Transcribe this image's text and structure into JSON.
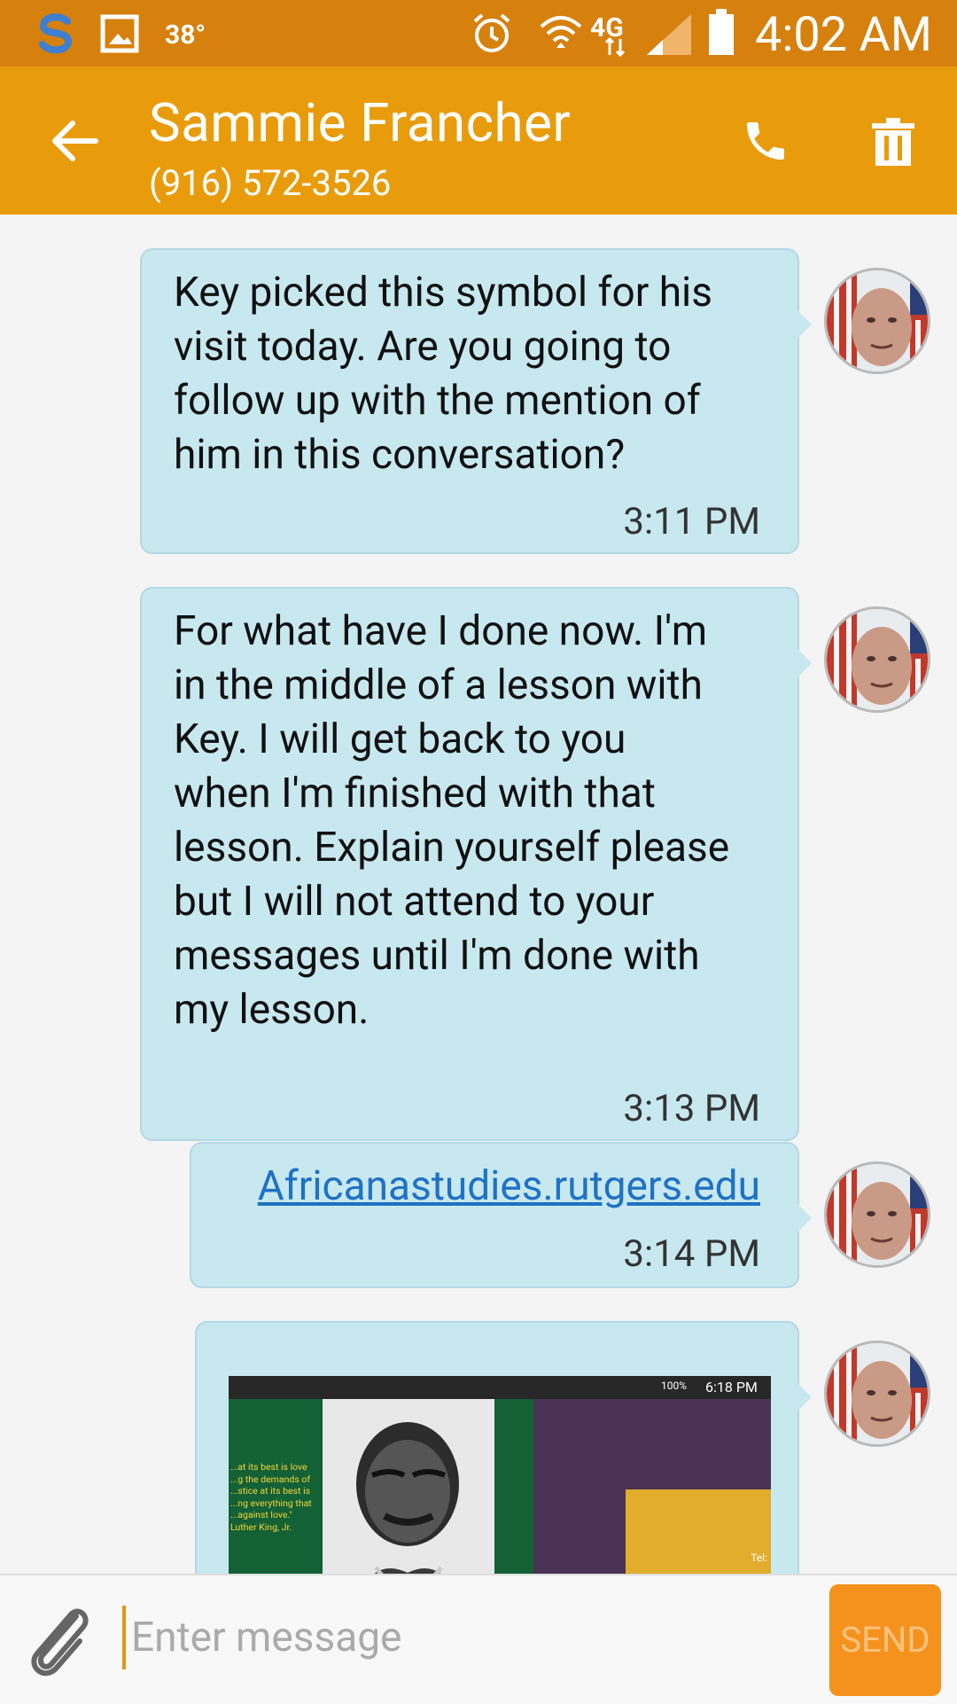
{
  "status_bar": {
    "temperature": "38°",
    "network_type": "4G",
    "time": "4:02 AM",
    "icons": [
      "s-app-icon",
      "gallery-icon",
      "alarm-icon",
      "wifi-icon",
      "lte-icon",
      "signal-icon",
      "battery-icon"
    ]
  },
  "header": {
    "contact_name": "Sammie Francher",
    "phone_number": "(916) 572-3526",
    "icons": [
      "back-arrow-icon",
      "phone-icon",
      "trash-icon"
    ]
  },
  "messages": [
    {
      "text": "Key picked this symbol for his visit today. Are you going to follow up with the mention of him in this conversation?",
      "lines": [
        "Key picked this symbol for his",
        "visit today. Are you going to",
        "follow up with the mention of",
        "him in this conversation?"
      ],
      "time": "3:11 PM"
    },
    {
      "text": "For what have I done now. I'm in the middle of a lesson with Key. I will get back to you when I'm finished with that lesson. Explain yourself please but I will not attend to your messages until I'm done with my lesson.",
      "lines": [
        "For what have I done now. I'm",
        "in the middle of a lesson with",
        "Key. I will get back to you",
        "when I'm finished with that",
        "lesson. Explain yourself please",
        "but I will not attend to your",
        "messages until I'm done with",
        "my lesson."
      ],
      "time": "3:13 PM"
    },
    {
      "link": "Africanastudies.rutgers.edu",
      "time": "3:14 PM"
    },
    {
      "attachment": {
        "status_time": "6:18 PM",
        "battery": "100%",
        "quote_lines": [
          "...at its best is love",
          "...g the demands of",
          "...stice at its best is",
          "...ng everything that",
          "...against love.\"",
          "Luther King, Jr."
        ],
        "tel_fragment": "Tel:"
      }
    }
  ],
  "composer": {
    "placeholder": "Enter message",
    "send_label": "SEND",
    "icons": [
      "paperclip-icon"
    ]
  },
  "colors": {
    "status_bar": "#d6800e",
    "app_bar": "#e89c0c",
    "bubble": "#c8e8f0",
    "send_button": "#f5921e",
    "link": "#1f72c4"
  }
}
